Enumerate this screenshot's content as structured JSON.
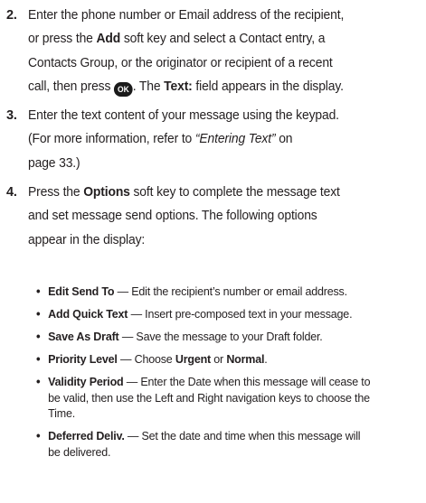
{
  "steps": [
    {
      "number": "2.",
      "lines": [
        [
          {
            "t": "Enter the phone number or Email address of the recipient,",
            "s": ""
          }
        ],
        [
          {
            "t": "or press the ",
            "s": ""
          },
          {
            "t": "Add",
            "s": "b"
          },
          {
            "t": " soft key and select a Contact entry, a",
            "s": ""
          }
        ],
        [
          {
            "t": "Contacts Group, or the originator or recipient of a recent",
            "s": ""
          }
        ],
        [
          {
            "t": "call, then press ",
            "s": ""
          },
          {
            "t": "OK",
            "s": "icon"
          },
          {
            "t": ". The ",
            "s": ""
          },
          {
            "t": "Text:",
            "s": "b"
          },
          {
            "t": " field appears in the display.",
            "s": ""
          }
        ]
      ]
    },
    {
      "number": "3.",
      "lines": [
        [
          {
            "t": "Enter the text content of your message using the keypad.",
            "s": ""
          }
        ],
        [
          {
            "t": "(For more information, refer to ",
            "s": ""
          },
          {
            "t": "“Entering Text”",
            "s": "i"
          },
          {
            "t": " on",
            "s": ""
          }
        ],
        [
          {
            "t": "page 33.)",
            "s": ""
          }
        ]
      ]
    },
    {
      "number": "4.",
      "lines": [
        [
          {
            "t": "Press the ",
            "s": ""
          },
          {
            "t": "Options",
            "s": "b"
          },
          {
            "t": " soft key to complete the message text",
            "s": ""
          }
        ],
        [
          {
            "t": "and set message send options. The following options",
            "s": ""
          }
        ],
        [
          {
            "t": "appear in the display:",
            "s": ""
          }
        ]
      ]
    }
  ],
  "ok_icon_name": "ok-key-icon",
  "options": [
    {
      "lines": [
        [
          {
            "t": "Edit Send To",
            "s": "b"
          },
          {
            "t": " — Edit the recipient’s number or email address.",
            "s": ""
          }
        ]
      ]
    },
    {
      "lines": [
        [
          {
            "t": "Add Quick Text",
            "s": "b"
          },
          {
            "t": " — Insert pre-composed text in your message.",
            "s": ""
          }
        ]
      ]
    },
    {
      "lines": [
        [
          {
            "t": "Save As Draft",
            "s": "b"
          },
          {
            "t": " — Save the message to your Draft folder.",
            "s": ""
          }
        ]
      ]
    },
    {
      "lines": [
        [
          {
            "t": "Priority Level",
            "s": "b"
          },
          {
            "t": " — Choose ",
            "s": ""
          },
          {
            "t": "Urgent",
            "s": "b"
          },
          {
            "t": " or ",
            "s": ""
          },
          {
            "t": "Normal",
            "s": "b"
          },
          {
            "t": ".",
            "s": ""
          }
        ]
      ]
    },
    {
      "lines": [
        [
          {
            "t": "Validity Period",
            "s": "b"
          },
          {
            "t": " — Enter the Date when this message will cease to",
            "s": ""
          }
        ],
        [
          {
            "t": "be valid, then use the Left and Right navigation keys to choose the",
            "s": ""
          }
        ],
        [
          {
            "t": "Time.",
            "s": ""
          }
        ]
      ]
    },
    {
      "lines": [
        [
          {
            "t": "Deferred Deliv.",
            "s": "b"
          },
          {
            "t": " — Set the date and time when this message will",
            "s": ""
          }
        ],
        [
          {
            "t": "be delivered.",
            "s": ""
          }
        ]
      ]
    }
  ]
}
